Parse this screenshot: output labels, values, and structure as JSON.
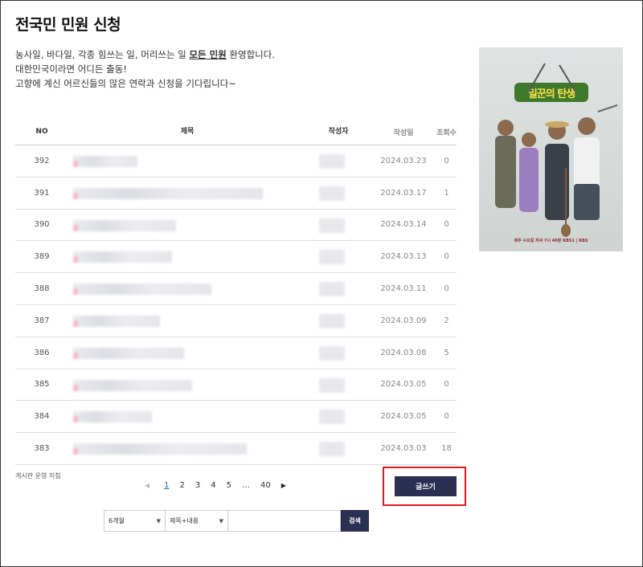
{
  "page": {
    "title": "전국민 민원 신청",
    "intro_line1_pre": "농사일, 바다일, 각종 힘쓰는 일, 머리쓰는 일 ",
    "intro_line1_hl": "모든 민원",
    "intro_line1_post": " 환영합니다.",
    "intro_line2": "대한민국이라면 어디든 출동!",
    "intro_line3": "고향에 계신 어르신들의 많은 연락과 신청을 기다립니다~"
  },
  "table": {
    "headers": {
      "no": "NO",
      "title": "제목",
      "author": "작성자",
      "date": "작성일",
      "views": "조회수"
    },
    "rows": [
      {
        "no": "392",
        "date": "2024.03.23",
        "views": "0"
      },
      {
        "no": "391",
        "date": "2024.03.17",
        "views": "1"
      },
      {
        "no": "390",
        "date": "2024.03.14",
        "views": "0"
      },
      {
        "no": "389",
        "date": "2024.03.13",
        "views": "0"
      },
      {
        "no": "388",
        "date": "2024.03.11",
        "views": "0"
      },
      {
        "no": "387",
        "date": "2024.03.09",
        "views": "2"
      },
      {
        "no": "386",
        "date": "2024.03.08",
        "views": "5"
      },
      {
        "no": "385",
        "date": "2024.03.05",
        "views": "0"
      },
      {
        "no": "384",
        "date": "2024.03.05",
        "views": "0"
      },
      {
        "no": "383",
        "date": "2024.03.03",
        "views": "18"
      }
    ]
  },
  "policy_link": "게시판 운영 지침",
  "pagination": {
    "prev_icon": "chevron-left-icon",
    "pages": [
      "1",
      "2",
      "3",
      "4",
      "5"
    ],
    "current": "1",
    "ellipsis": "…",
    "last": "40",
    "next_icon": "chevron-right-icon"
  },
  "write_button": "글쓰기",
  "search": {
    "period": "6개월",
    "field": "제목+내용",
    "query": "",
    "button": "검색"
  },
  "poster": {
    "logo": "일꾼의 탄생",
    "tagline": "매주 수요일 저녁 7시 40분 KBS1 | KBS"
  },
  "colors": {
    "accent_navy": "#2b2f52",
    "highlight_red": "#e5171e",
    "current_page_blue": "#1a73c6"
  }
}
